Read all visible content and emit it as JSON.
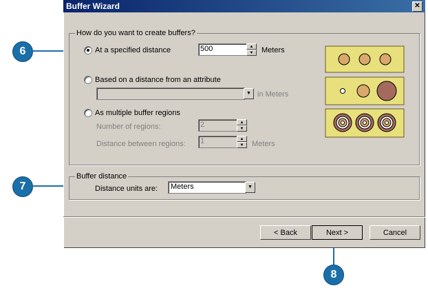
{
  "window": {
    "title": "Buffer Wizard",
    "close_symbol": "✕"
  },
  "create_group": {
    "legend": "How do you want to create buffers?",
    "options": [
      {
        "label": "At a specified distance",
        "selected": true,
        "value": "500",
        "units": "Meters"
      },
      {
        "label": "Based on a distance from an attribute",
        "selected": false,
        "units": "in Meters"
      },
      {
        "label": "As multiple buffer regions",
        "selected": false,
        "regions_label": "Number of regions:",
        "regions_value": "2",
        "distance_label": "Distance between regions:",
        "distance_value": "1",
        "units": "Meters"
      }
    ]
  },
  "distance_group": {
    "legend": "Buffer distance",
    "label": "Distance units are:",
    "value": "Meters"
  },
  "buttons": {
    "back": "< Back",
    "next": "Next >",
    "cancel": "Cancel"
  },
  "callouts": [
    "6",
    "7",
    "8"
  ],
  "colors": {
    "accent": "#1b6fa8",
    "preview_bg": "#e8e07c",
    "preview_fill": "#d9a86c",
    "dark_fill": "#a46a5e"
  }
}
